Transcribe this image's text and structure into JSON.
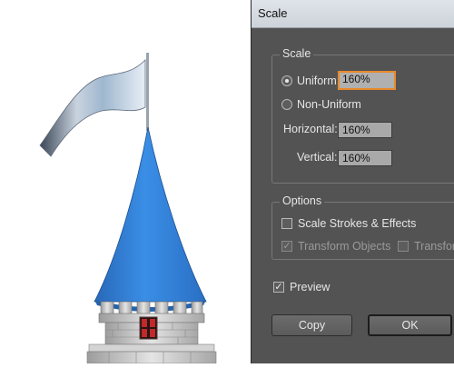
{
  "dialog": {
    "title": "Scale",
    "scale_group": {
      "legend": "Scale",
      "uniform_label": "Uniform:",
      "uniform_value": "160%",
      "uniform_selected": true,
      "non_uniform_label": "Non-Uniform",
      "horizontal_label": "Horizontal:",
      "horizontal_value": "160%",
      "vertical_label": "Vertical:",
      "vertical_value": "160%"
    },
    "options_group": {
      "legend": "Options",
      "scale_strokes_label": "Scale Strokes & Effects",
      "scale_strokes_checked": false,
      "transform_objects_label": "Transform Objects",
      "transform_objects_checked": true,
      "transform_patterns_label": "Transform Patterns",
      "transform_patterns_checked": false
    },
    "preview_label": "Preview",
    "preview_checked": true,
    "copy_button": "Copy",
    "ok_button": "OK"
  },
  "colors": {
    "dialog_bg": "#535353",
    "roof_blue": "#2f7fd6",
    "focus_orange": "#e88a2b"
  }
}
